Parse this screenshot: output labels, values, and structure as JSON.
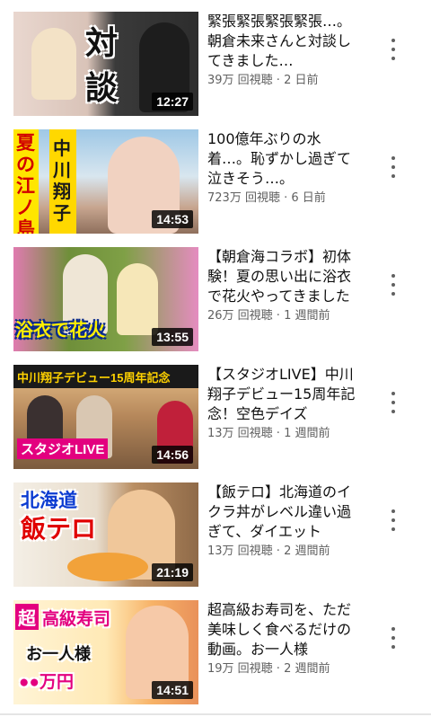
{
  "videos": [
    {
      "title": "緊張緊張緊張緊張…。朝倉未来さんと対談してきました…",
      "meta": "39万 回視聴 · 2 日前",
      "duration": "12:27",
      "overlay": [
        "対",
        "談"
      ]
    },
    {
      "title": "100億年ぶりの水着…。恥ずかし過ぎて泣きそう…。",
      "meta": "723万 回視聴 · 6 日前",
      "duration": "14:53",
      "overlay": [
        "夏の江ノ島",
        "中川翔子"
      ]
    },
    {
      "title": "【朝倉海コラボ】初体験！夏の思い出に浴衣で花火やってきました",
      "meta": "26万 回視聴 · 1 週間前",
      "duration": "13:55",
      "overlay": [
        "浴衣で花火"
      ]
    },
    {
      "title": "【スタジオLIVE】中川翔子デビュー15周年記念！空色デイズ",
      "meta": "13万 回視聴 · 1 週間前",
      "duration": "14:56",
      "overlay": [
        "中川翔子デビュー15周年記念",
        "スタジオLIVE"
      ]
    },
    {
      "title": "【飯テロ】北海道のイクラ丼がレベル違い過ぎて、ダイエット",
      "meta": "13万 回視聴 · 2 週間前",
      "duration": "21:19",
      "overlay": [
        "北海道",
        "飯テロ"
      ]
    },
    {
      "title": "超高級お寿司を、ただ美味しく食べるだけの動画。お一人様",
      "meta": "19万 回視聴 · 2 週間前",
      "duration": "14:51",
      "overlay": [
        "超",
        "高級寿司",
        "お一人様",
        "●●万円"
      ]
    }
  ]
}
